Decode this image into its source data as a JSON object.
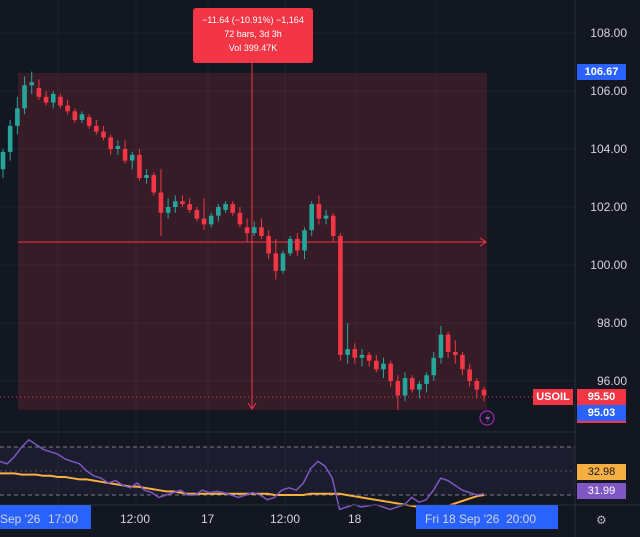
{
  "symbol": "USOIL",
  "price_axis": {
    "ticks": [
      "108.00",
      "106.00",
      "104.00",
      "102.00",
      "100.00",
      "98.00",
      "96.00"
    ]
  },
  "price_badges": {
    "crosshair_high": "106.67",
    "last": "95.50",
    "ref": "95.03"
  },
  "measure_tooltip": {
    "line1": "−11.64 (−10.91%) −1,164",
    "line2": "72 bars, 3d 3h",
    "line3": "Vol 399.47K"
  },
  "rsi_badges": {
    "upper": "32.98",
    "lower": "31.99"
  },
  "time_axis": {
    "labels": [
      "Sep '26",
      "17:00",
      "12:00",
      "17",
      "12:00",
      "18"
    ],
    "highlight_left": "Sep '26  17:00",
    "highlight_right": "Fri 18 Sep '26  20:00"
  },
  "icons": {
    "settings": "gear-icon",
    "alert": "lightning-icon"
  },
  "colors": {
    "up": "#26a69a",
    "down": "#f23645",
    "rsi": "#7e57c2",
    "ma": "#f5b041",
    "accent": "#2962ff"
  },
  "chart_data": {
    "type": "candlestick",
    "yrange": [
      94.5,
      109
    ],
    "candles": [
      [
        103.3,
        104.0,
        103.0,
        103.9
      ],
      [
        103.9,
        105.0,
        103.6,
        104.8
      ],
      [
        104.8,
        105.8,
        104.5,
        105.4
      ],
      [
        105.4,
        106.5,
        105.2,
        106.2
      ],
      [
        106.2,
        106.67,
        105.9,
        106.3
      ],
      [
        106.1,
        106.4,
        105.7,
        105.8
      ],
      [
        105.8,
        106.0,
        105.5,
        105.6
      ],
      [
        105.6,
        106.0,
        105.4,
        105.9
      ],
      [
        105.8,
        105.9,
        105.4,
        105.5
      ],
      [
        105.5,
        105.7,
        105.2,
        105.3
      ],
      [
        105.3,
        105.4,
        104.9,
        105.0
      ],
      [
        105.0,
        105.3,
        104.9,
        105.2
      ],
      [
        105.1,
        105.2,
        104.7,
        104.8
      ],
      [
        104.8,
        105.0,
        104.5,
        104.6
      ],
      [
        104.6,
        104.8,
        104.3,
        104.4
      ],
      [
        104.4,
        104.5,
        103.8,
        104.0
      ],
      [
        104.0,
        104.3,
        103.8,
        104.1
      ],
      [
        104.0,
        104.3,
        103.5,
        103.6
      ],
      [
        103.6,
        103.9,
        103.3,
        103.8
      ],
      [
        103.8,
        104.0,
        102.9,
        103.0
      ],
      [
        103.0,
        103.3,
        102.8,
        103.1
      ],
      [
        103.1,
        103.2,
        102.4,
        102.5
      ],
      [
        102.5,
        103.3,
        101.0,
        101.8
      ],
      [
        101.8,
        102.3,
        101.6,
        102.0
      ],
      [
        102.0,
        102.4,
        101.8,
        102.2
      ],
      [
        102.2,
        102.4,
        102.0,
        102.1
      ],
      [
        102.1,
        102.3,
        101.8,
        101.9
      ],
      [
        101.9,
        102.0,
        101.5,
        101.6
      ],
      [
        101.6,
        102.3,
        101.2,
        101.4
      ],
      [
        101.4,
        101.8,
        101.3,
        101.7
      ],
      [
        101.7,
        102.1,
        101.5,
        102.0
      ],
      [
        101.9,
        102.2,
        101.8,
        102.1
      ],
      [
        102.1,
        102.2,
        101.7,
        101.8
      ],
      [
        101.8,
        102.0,
        101.3,
        101.4
      ],
      [
        101.3,
        101.6,
        100.8,
        101.1
      ],
      [
        101.1,
        101.5,
        101.0,
        101.3
      ],
      [
        101.3,
        101.6,
        100.9,
        101.0
      ],
      [
        101.0,
        101.2,
        100.2,
        100.4
      ],
      [
        100.4,
        100.9,
        99.5,
        99.8
      ],
      [
        99.8,
        100.5,
        99.7,
        100.4
      ],
      [
        100.4,
        101.0,
        100.3,
        100.9
      ],
      [
        100.9,
        101.1,
        100.3,
        100.5
      ],
      [
        100.5,
        101.3,
        100.2,
        101.2
      ],
      [
        101.2,
        102.2,
        101.0,
        102.1
      ],
      [
        102.1,
        102.4,
        101.4,
        101.6
      ],
      [
        101.6,
        101.9,
        101.4,
        101.7
      ],
      [
        101.7,
        101.8,
        100.8,
        101.0
      ],
      [
        101.0,
        101.1,
        96.7,
        96.9
      ],
      [
        96.9,
        98.0,
        96.6,
        97.1
      ],
      [
        97.1,
        97.3,
        96.6,
        96.8
      ],
      [
        96.8,
        97.1,
        96.5,
        96.9
      ],
      [
        96.9,
        97.0,
        96.5,
        96.7
      ],
      [
        96.7,
        96.9,
        96.3,
        96.4
      ],
      [
        96.4,
        96.8,
        96.1,
        96.6
      ],
      [
        96.6,
        96.7,
        95.8,
        96.0
      ],
      [
        96.0,
        96.2,
        95.0,
        95.5
      ],
      [
        95.5,
        96.3,
        95.3,
        96.1
      ],
      [
        96.1,
        96.2,
        95.6,
        95.7
      ],
      [
        95.7,
        96.0,
        95.4,
        95.9
      ],
      [
        95.9,
        96.3,
        95.6,
        96.2
      ],
      [
        96.2,
        97.0,
        96.0,
        96.8
      ],
      [
        96.8,
        97.9,
        96.6,
        97.6
      ],
      [
        97.6,
        97.7,
        96.8,
        97.0
      ],
      [
        97.0,
        97.4,
        96.6,
        96.9
      ],
      [
        96.9,
        97.0,
        96.2,
        96.4
      ],
      [
        96.4,
        96.6,
        95.8,
        96.0
      ],
      [
        96.0,
        96.1,
        95.4,
        95.7
      ],
      [
        95.7,
        95.8,
        95.3,
        95.5
      ]
    ],
    "rsi": [
      58,
      56,
      62,
      70,
      76,
      72,
      68,
      66,
      64,
      60,
      58,
      56,
      50,
      46,
      44,
      40,
      42,
      38,
      36,
      40,
      34,
      32,
      28,
      30,
      32,
      34,
      30,
      30,
      34,
      32,
      33,
      32,
      30,
      28,
      30,
      32,
      30,
      26,
      28,
      34,
      36,
      34,
      40,
      52,
      58,
      54,
      44,
      18,
      20,
      22,
      20,
      21,
      22,
      20,
      18,
      20,
      22,
      28,
      24,
      26,
      34,
      44,
      42,
      38,
      34,
      32,
      30,
      31
    ],
    "ma": [
      48,
      48,
      48,
      47,
      47,
      47,
      46,
      46,
      45,
      45,
      44,
      43,
      43,
      42,
      41,
      40,
      39,
      38,
      37,
      37,
      36,
      35,
      34,
      33,
      33,
      32,
      31,
      31,
      31,
      31,
      31,
      31,
      31,
      31,
      31,
      31,
      31,
      31,
      30,
      30,
      30,
      30,
      30,
      31,
      31,
      31,
      31,
      31,
      30,
      29,
      28,
      27,
      26,
      25,
      24,
      23,
      22,
      21,
      20,
      19,
      19,
      20,
      21,
      23,
      25,
      27,
      29,
      30
    ]
  }
}
